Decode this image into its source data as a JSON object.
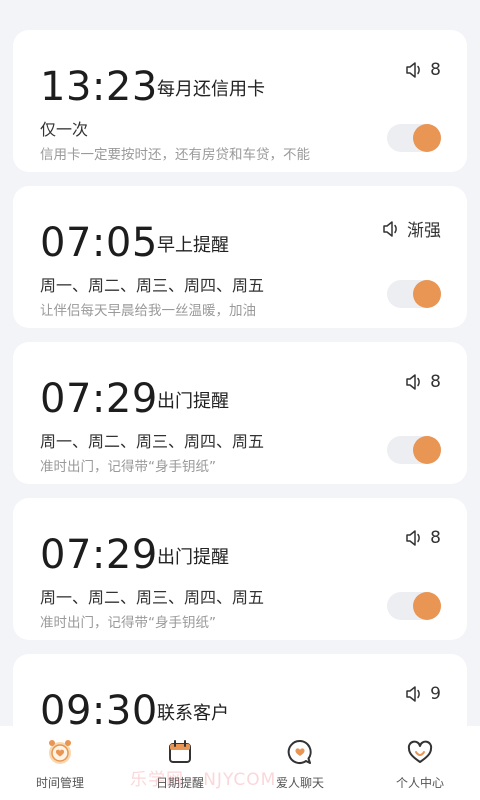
{
  "alarms": [
    {
      "time": "13:23",
      "title": "每月还信用卡",
      "repeat": "仅一次",
      "note": "信用卡一定要按时还，还有房贷和车贷，不能",
      "sound": "8",
      "enabled": true
    },
    {
      "time": "07:05",
      "title": "早上提醒",
      "repeat": "周一、周二、周三、周四、周五",
      "note": "让伴侣每天早晨给我一丝温暖，加油",
      "sound": "渐强",
      "enabled": true
    },
    {
      "time": "07:29",
      "title": "出门提醒",
      "repeat": "周一、周二、周三、周四、周五",
      "note": "准时出门，记得带“身手钥纸”",
      "sound": "8",
      "enabled": true
    },
    {
      "time": "07:29",
      "title": "出门提醒",
      "repeat": "周一、周二、周三、周四、周五",
      "note": "准时出门，记得带“身手钥纸”",
      "sound": "8",
      "enabled": true
    },
    {
      "time": "09:30",
      "title": "联系客户",
      "repeat": "",
      "note": "",
      "sound": "9",
      "enabled": true
    }
  ],
  "tabs": [
    {
      "label": "时间管理",
      "icon": "alarm-clock-icon",
      "active": true
    },
    {
      "label": "日期提醒",
      "icon": "calendar-icon",
      "active": false
    },
    {
      "label": "爱人聊天",
      "icon": "chat-heart-icon",
      "active": false
    },
    {
      "label": "个人中心",
      "icon": "heart-profile-icon",
      "active": false
    }
  ],
  "watermark": "乐学网 · NJYCOM",
  "colors": {
    "accent": "#e99553",
    "toggle_track": "#eceef2",
    "background": "#f3f4f8"
  }
}
